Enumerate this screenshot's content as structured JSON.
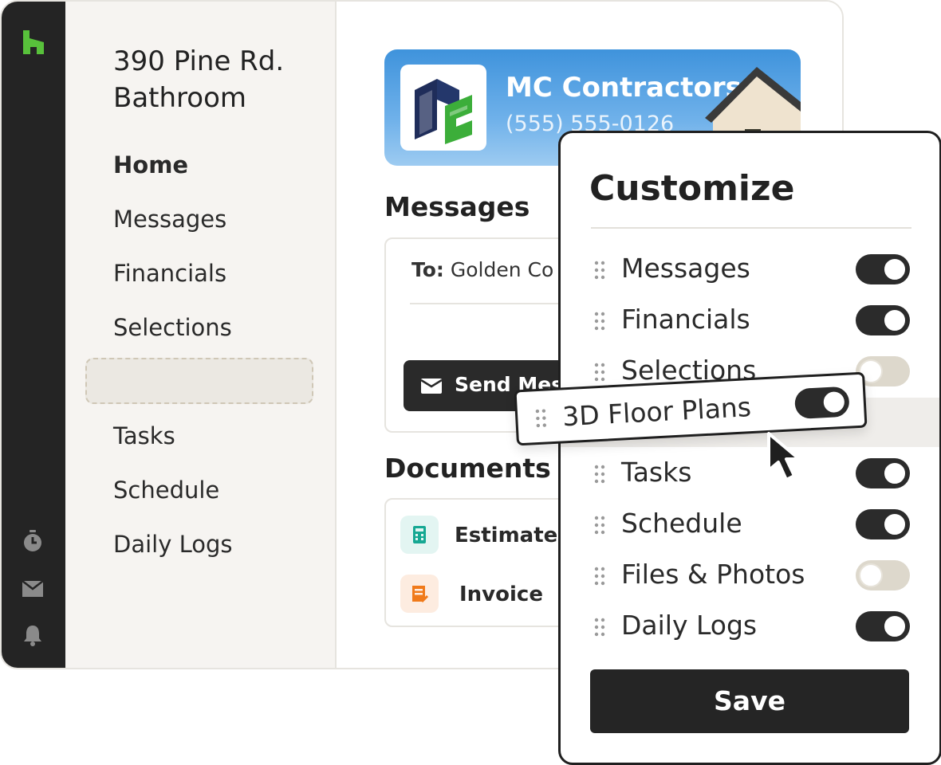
{
  "rail": {
    "logo_color": "#58c13b",
    "icons": [
      "stopwatch-icon",
      "inbox-icon",
      "bell-icon"
    ]
  },
  "sidebar": {
    "project_title": "390 Pine Rd. Bathroom",
    "items": [
      {
        "label": "Home",
        "active": true
      },
      {
        "label": "Messages"
      },
      {
        "label": "Financials"
      },
      {
        "label": "Selections"
      },
      {
        "label": "Tasks"
      },
      {
        "label": "Schedule"
      },
      {
        "label": "Daily Logs"
      }
    ]
  },
  "banner": {
    "company": "MC Contractors",
    "phone": "(555) 555-0126"
  },
  "messages": {
    "title": "Messages",
    "to_label": "To:",
    "to_value": "Golden Co",
    "send_label": "Send Mess"
  },
  "documents": {
    "title": "Documents",
    "items": [
      {
        "label": "Estimate",
        "icon": "calculator-icon",
        "color": "#16a893"
      },
      {
        "label": "Invoice",
        "icon": "invoice-icon",
        "color": "#f07a1a"
      }
    ]
  },
  "customize": {
    "title": "Customize",
    "rows": [
      {
        "label": "Messages",
        "on": true
      },
      {
        "label": "Financials",
        "on": true
      },
      {
        "label": "Selections",
        "on": false
      },
      {
        "label": "Tasks",
        "on": true
      },
      {
        "label": "Schedule",
        "on": true
      },
      {
        "label": "Files & Photos",
        "on": false
      },
      {
        "label": "Daily Logs",
        "on": true
      }
    ],
    "dragging": {
      "label": "3D Floor Plans",
      "on": true
    },
    "save_label": "Save"
  },
  "colors": {
    "rail": "#242424",
    "accent_green": "#58c13b",
    "toggle_on": "#2b2b2b",
    "toggle_off": "#ddd8cc"
  }
}
